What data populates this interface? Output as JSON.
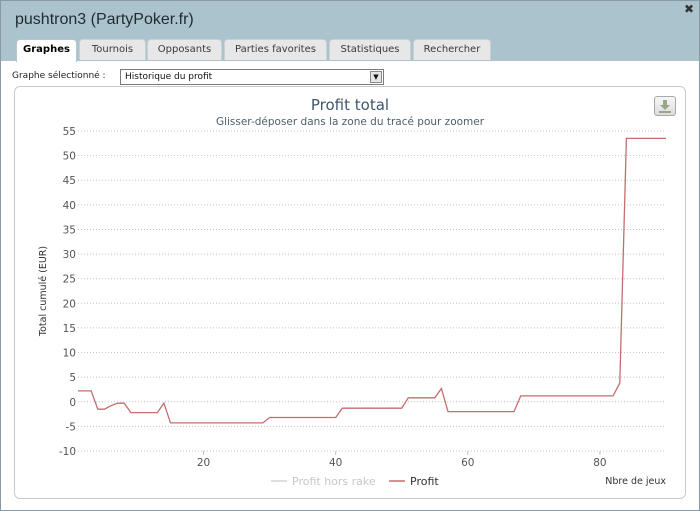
{
  "window": {
    "title": "pushtron3 (PartyPoker.fr)",
    "close_icon": "close-icon"
  },
  "tabs": [
    {
      "label": "Graphes",
      "active": true
    },
    {
      "label": "Tournois",
      "active": false
    },
    {
      "label": "Opposants",
      "active": false
    },
    {
      "label": "Parties favorites",
      "active": false
    },
    {
      "label": "Statistiques",
      "active": false
    },
    {
      "label": "Rechercher",
      "active": false
    }
  ],
  "graph_select": {
    "label": "Graphe sélectionné :",
    "value": "Historique du profit"
  },
  "download_icon": "download-icon",
  "colors": {
    "header": "#abc3cc",
    "profit_line": "#c36e6e",
    "profit_hors_rake_line": "#d2d2d2"
  },
  "chart_data": {
    "type": "line",
    "title": "Profit total",
    "subtitle": "Glisser-déposer dans la zone du tracé pour zoomer",
    "xlabel": "Nbre de jeux",
    "ylabel": "Total cumulé (EUR)",
    "xlim": [
      1,
      90
    ],
    "ylim": [
      -10,
      55
    ],
    "xticks": [
      20,
      40,
      60,
      80
    ],
    "yticks": [
      -10,
      -5,
      0,
      5,
      10,
      15,
      20,
      25,
      30,
      35,
      40,
      45,
      50,
      55
    ],
    "grid": true,
    "legend_position": "bottom",
    "series": [
      {
        "name": "Profit hors rake",
        "visible": false,
        "x": [],
        "y": []
      },
      {
        "name": "Profit",
        "visible": true,
        "x": [
          1,
          3,
          4,
          5,
          6,
          7,
          8,
          9,
          10,
          13,
          14,
          15,
          25,
          29,
          30,
          40,
          41,
          50,
          51,
          55,
          56,
          57,
          60,
          65,
          67,
          68,
          80,
          82,
          83,
          84,
          90
        ],
        "y": [
          2.2,
          2.2,
          -1.5,
          -1.5,
          -0.8,
          -0.3,
          -0.3,
          -2.2,
          -2.2,
          -2.2,
          -0.3,
          -4.3,
          -4.3,
          -4.3,
          -3.2,
          -3.2,
          -1.3,
          -1.3,
          0.8,
          0.8,
          2.7,
          -2.0,
          -2.0,
          -2.0,
          -2.0,
          1.2,
          1.2,
          1.2,
          3.8,
          53.5,
          53.5
        ]
      }
    ]
  }
}
